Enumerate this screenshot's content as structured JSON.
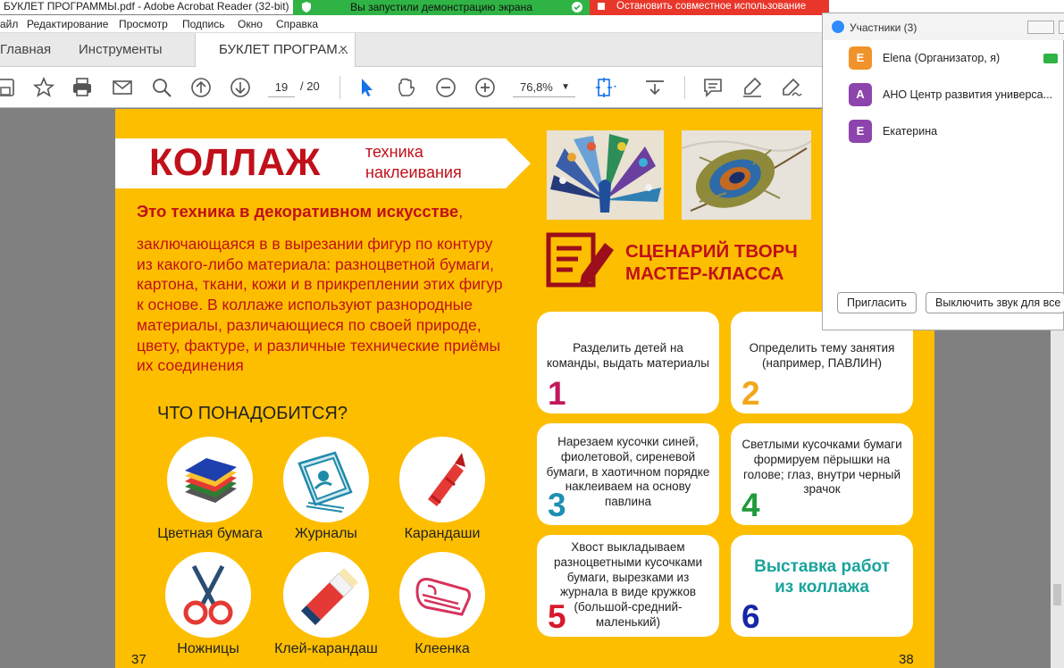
{
  "window": {
    "title": "БУКЛЕТ ПРОГРАММЫ.pdf - Adobe Acrobat Reader (32-bit)"
  },
  "share_banner": {
    "status": "Вы запустили демонстрацию экрана",
    "stop": "Остановить совместное использование"
  },
  "menu": [
    "айл",
    "Редактирование",
    "Просмотр",
    "Подпись",
    "Окно",
    "Справка"
  ],
  "tabs": {
    "home": "Главная",
    "tools": "Инструменты",
    "document": "БУКЛЕТ ПРОГРАМ...",
    "close": "×"
  },
  "toolbar": {
    "current_page": "19",
    "page_separator": "/",
    "total_pages": "20",
    "zoom": "76,8%"
  },
  "booklet": {
    "title": "КОЛЛАЖ",
    "subtitle_line1": "техника",
    "subtitle_line2": "наклеивания",
    "intro_bold": "Это техника в декоративном искусстве",
    "intro_comma": ",",
    "intro_text": "заключающаяся в в вырезании фигур по контуру из какого-либо материала: разноцветной бумаги, картона, ткани, кожи и в прикреплении этих фигур к основе. В коллаже используют разнородные материалы, различающиеся по своей природе, цвету, фактуре, и различные технические приёмы их соединения",
    "needs_heading": "ЧТО ПОНАДОБИТСЯ?",
    "tools": [
      {
        "label": "Цветная бумага"
      },
      {
        "label": "Журналы"
      },
      {
        "label": "Карандаши"
      },
      {
        "label": "Ножницы"
      },
      {
        "label": "Клей-карандаш"
      },
      {
        "label": "Клеенка"
      }
    ],
    "scenario_line1": "СЦЕНАРИЙ ТВОРЧ",
    "scenario_line2": "МАСТЕР-КЛАССА",
    "steps": [
      {
        "num": "1",
        "text": "Разделить детей на команды, выдать материалы",
        "color": "#c2185b"
      },
      {
        "num": "2",
        "text": "Определить тему занятия (например, ПАВЛИН)",
        "color": "#f2a71b"
      },
      {
        "num": "3",
        "text": "Нарезаем кусочки синей, фиолетовой, сиреневой бумаги, в хаотичном порядке наклеиваем на основу павлина",
        "color": "#1e90b4"
      },
      {
        "num": "4",
        "text": "Светлыми кусочками бумаги формируем пёрышки на голове; глаз, внутри черный зрачок",
        "color": "#1f9b3a"
      },
      {
        "num": "5",
        "text": "Хвост выкладываем разноцветными кусочками бумаги, вырезками из журнала в виде кружков (большой-средний-маленький)",
        "color": "#d7192b"
      },
      {
        "num": "6",
        "text": "Выставка работ из коллажа",
        "color": "#1726a8"
      }
    ],
    "page_left": "37",
    "page_right": "38"
  },
  "participants": {
    "title": "Участники (3)",
    "list": [
      {
        "initial": "E",
        "name": "Elena (Организатор, я)",
        "color": "#f0932b"
      },
      {
        "initial": "А",
        "name": "АНО Центр развития универса...",
        "color": "#8e44ad"
      },
      {
        "initial": "Е",
        "name": "Екатерина",
        "color": "#8e44ad"
      }
    ],
    "invite": "Пригласить",
    "mute_all": "Выключить звук для все"
  }
}
